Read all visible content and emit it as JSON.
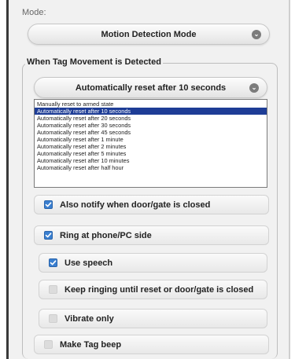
{
  "mode": {
    "label": "Mode:",
    "selected": "Motion Detection Mode"
  },
  "tag_movement": {
    "legend": "When Tag Movement is Detected",
    "selected": "Automatically reset after 10 seconds",
    "options": [
      "Manually reset to armed state",
      "Automatically reset after 10 seconds",
      "Automatically reset after 20 seconds",
      "Automatically reset after 30 seconds",
      "Automatically reset after 45 seconds",
      "Automatically reset after 1 minute",
      "Automatically reset after 2 minutes",
      "Automatically reset after 5 minutes",
      "Automatically reset after 10 minutes",
      "Automatically reset after half hour"
    ],
    "selected_index": 1
  },
  "checkboxes": {
    "notify_closed": {
      "label": "Also notify when door/gate is closed",
      "checked": true
    },
    "ring_phone": {
      "label": "Ring at phone/PC side",
      "checked": true
    },
    "use_speech": {
      "label": "Use speech",
      "checked": true
    },
    "keep_ringing": {
      "label": "Keep ringing until reset or door/gate is closed",
      "checked": false
    },
    "vibrate_only": {
      "label": "Vibrate only",
      "checked": false
    },
    "tag_beep": {
      "label": "Make Tag beep",
      "checked": false
    }
  },
  "colors": {
    "accent": "#3a7fd0",
    "selection": "#1e3d96",
    "panel": "#f1f1f1"
  }
}
